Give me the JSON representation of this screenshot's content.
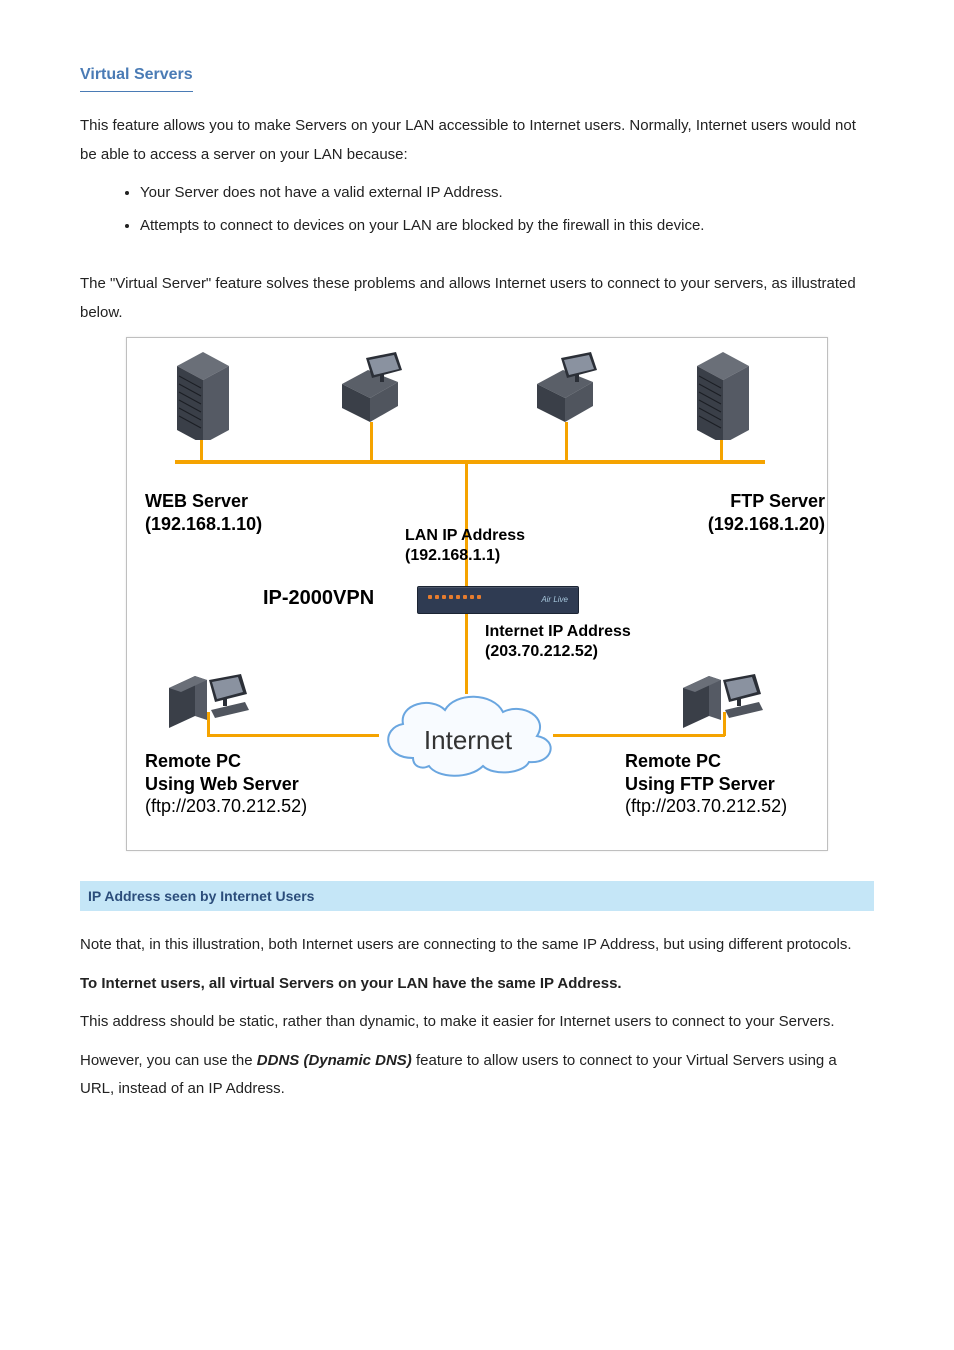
{
  "section_title": "Virtual Servers",
  "intro_para": "This feature allows you to make Servers on your LAN accessible to Internet users. Normally, Internet users would not be able to access a server on your LAN because:",
  "bullets": [
    "Your Server does not have a valid external IP Address.",
    "Attempts to connect to devices on your LAN are blocked by the firewall in this device."
  ],
  "para2": "The \"Virtual Server\" feature solves these problems and allows Internet users to connect to your servers, as illustrated below.",
  "figure": {
    "web_server_label": "WEB Server",
    "web_server_ip": "(192.168.1.10)",
    "ftp_server_label": "FTP Server",
    "ftp_server_ip": "(192.168.1.20)",
    "lan_ip_label": "LAN IP Address",
    "lan_ip_value": "(192.168.1.1)",
    "device_label": "IP-2000VPN",
    "internet_ip_label": "Internet IP Address",
    "internet_ip_value": "(203.70.212.52)",
    "internet_cloud": "Internet",
    "remote_left_line1": "Remote PC",
    "remote_left_line2": "Using Web Server",
    "remote_left_line3": "(ftp://203.70.212.52)",
    "remote_right_line1": "Remote PC",
    "remote_right_line2": "Using FTP Server",
    "remote_right_line3": "(ftp://203.70.212.52)"
  },
  "band_title": "IP Address seen by Internet Users",
  "band_para": "Note that, in this illustration, both Internet users are connecting to the same IP Address, but using different protocols.",
  "seen_emph": "To Internet users, all virtual Servers on your LAN have the same IP Address.",
  "static_para": "This address should be static, rather than dynamic, to make it easier for Internet users to connect to your Servers.",
  "however_pre": "However, you can use the ",
  "ddns_emph": "DDNS (Dynamic DNS)",
  "however_post": " feature to allow users to connect to your Virtual Servers using a URL, instead of an IP Address."
}
